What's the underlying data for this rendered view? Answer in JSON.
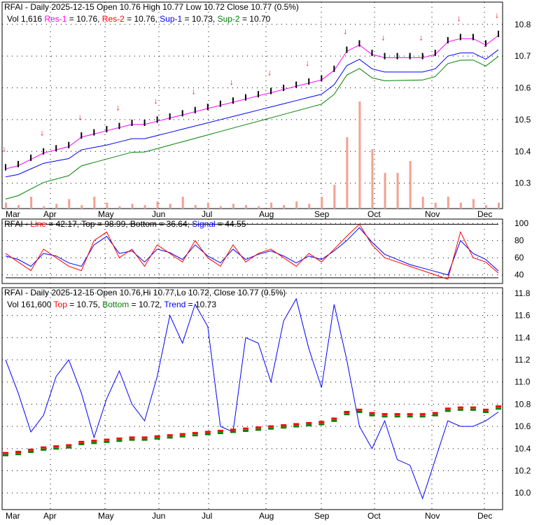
{
  "colors": {
    "res1": "#ff00ff",
    "res2": "#ff0000",
    "sup1": "#0000ff",
    "sup2": "#008000",
    "volume": "#f4a090",
    "up": "#008000",
    "down": "#ff0000"
  },
  "chart_data": [
    {
      "type": "line",
      "panel": "price",
      "header": {
        "title": "RFAI - Daily 2025-12-15 Open 10.76  High 10.77  Low 10.72  Close 10.77 (0.5%)",
        "vol": "Vol 1,616",
        "res1": "Res-1",
        "res1_val": " = 10.76, ",
        "res2": "Res-2",
        "res2_val": " = 10.76, ",
        "sup1": "Sup-1",
        "sup1_val": " = 10.73, ",
        "sup2": "Sup-2",
        "sup2_val": " = 10.70"
      },
      "ylim": [
        10.22,
        10.87
      ],
      "yticks": [
        "10.8",
        "10.7",
        "10.6",
        "10.5",
        "10.4",
        "10.3"
      ],
      "months": [
        "Mar",
        "Apr",
        "May",
        "Jun",
        "Jul",
        "Aug",
        "Sep",
        "Oct",
        "Nov",
        "Dec"
      ],
      "close": [
        10.35,
        10.36,
        10.38,
        10.4,
        10.41,
        10.42,
        10.45,
        10.46,
        10.47,
        10.48,
        10.49,
        10.49,
        10.5,
        10.51,
        10.52,
        10.53,
        10.54,
        10.55,
        10.56,
        10.57,
        10.58,
        10.59,
        10.6,
        10.61,
        10.62,
        10.63,
        10.66,
        10.72,
        10.74,
        10.71,
        10.7,
        10.7,
        10.7,
        10.7,
        10.71,
        10.75,
        10.76,
        10.76,
        10.74,
        10.77
      ],
      "volume": [
        0.05,
        0.03,
        0.1,
        0.02,
        0.04,
        0.08,
        0.03,
        0.1,
        0.05,
        0.02,
        0.04,
        0.03,
        0.06,
        0.04,
        0.1,
        0.03,
        0.05,
        0.02,
        0.04,
        0.03,
        0.02,
        0.05,
        0.03,
        0.06,
        0.04,
        0.1,
        0.2,
        0.6,
        0.9,
        0.5,
        0.3,
        0.3,
        0.4,
        0.1,
        0.05,
        0.1,
        0.05,
        0.08,
        0.03,
        0.05
      ]
    },
    {
      "type": "line",
      "panel": "oscillator",
      "header": {
        "name": "RFAI - ",
        "line": "Line",
        "line_val": " = 42.17, Top = 98.99, Bottom = 36.64, ",
        "signal": "Signal",
        "signal_val": " = 44.55"
      },
      "ylim": [
        30,
        105
      ],
      "yticks": [
        "100",
        "80",
        "60",
        "40"
      ],
      "line": [
        65,
        55,
        45,
        70,
        60,
        50,
        45,
        80,
        90,
        60,
        70,
        50,
        75,
        65,
        55,
        80,
        60,
        50,
        75,
        55,
        65,
        70,
        60,
        50,
        65,
        55,
        70,
        85,
        99,
        75,
        60,
        55,
        50,
        45,
        40,
        35,
        90,
        60,
        55,
        42
      ],
      "signal": [
        62,
        58,
        50,
        65,
        62,
        54,
        50,
        75,
        85,
        65,
        68,
        55,
        70,
        66,
        58,
        75,
        62,
        54,
        70,
        58,
        64,
        68,
        62,
        54,
        62,
        58,
        68,
        80,
        95,
        78,
        64,
        58,
        52,
        48,
        44,
        40,
        80,
        65,
        58,
        44.55
      ]
    },
    {
      "type": "line",
      "panel": "trend",
      "header": {
        "title": "RFAI - Daily 2025-12-15 Open 10.76,Hi 10.77,Lo 10.72, Close 10.77 (0.5%)",
        "vol": "Vol 161,600 ",
        "top": "Top",
        "top_val": " = 10.75, ",
        "bottom": "Bottom",
        "bottom_val": " = 10.72, ",
        "trend": "Trend",
        "trend_val": " = 10.73"
      },
      "ylim": [
        9.85,
        11.85
      ],
      "yticks": [
        "11.8",
        "11.6",
        "11.4",
        "11.2",
        "11.0",
        "10.8",
        "10.6",
        "10.4",
        "10.2",
        "10.0"
      ],
      "trend": [
        11.2,
        10.9,
        10.55,
        10.7,
        11.05,
        11.2,
        10.9,
        10.5,
        10.85,
        11.1,
        10.8,
        10.65,
        11.05,
        11.6,
        11.35,
        11.7,
        11.5,
        10.6,
        10.55,
        11.4,
        11.35,
        11.0,
        11.55,
        11.75,
        11.3,
        10.95,
        11.7,
        11.2,
        10.6,
        10.4,
        10.65,
        10.3,
        10.25,
        9.95,
        10.3,
        10.65,
        10.6,
        10.6,
        10.65,
        10.73
      ]
    }
  ]
}
